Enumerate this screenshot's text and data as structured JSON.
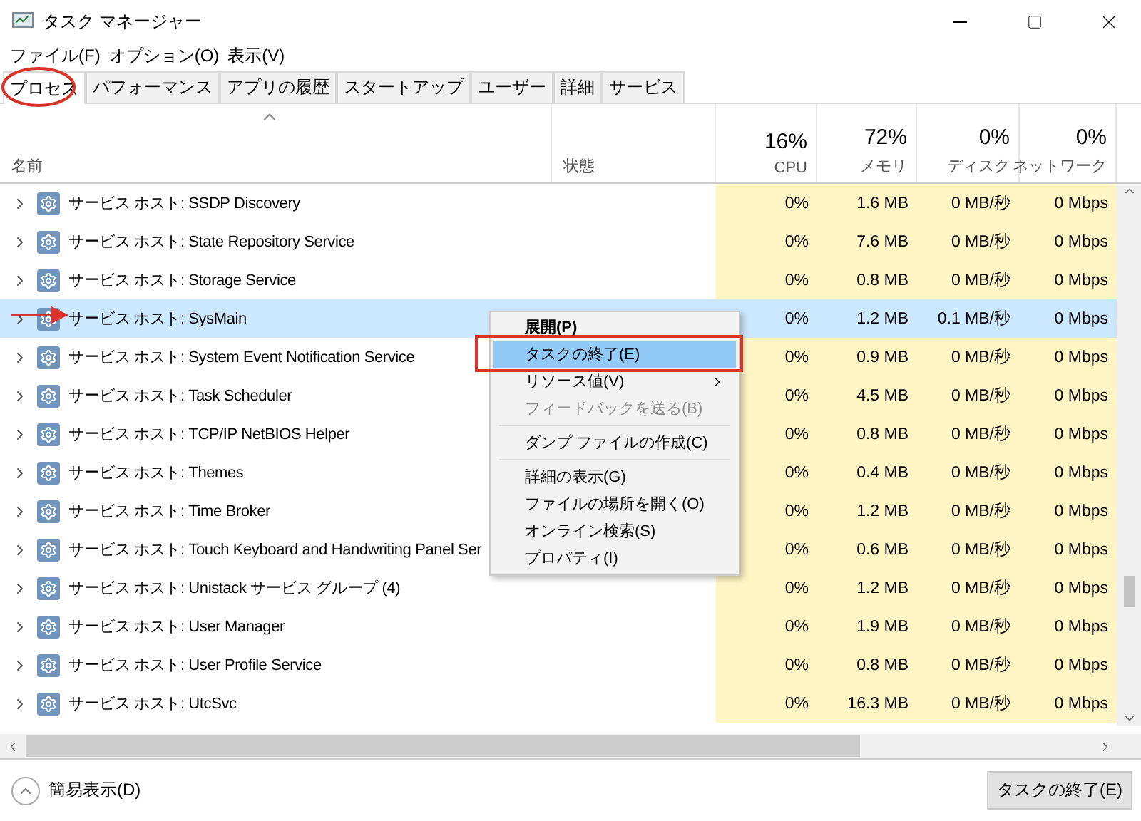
{
  "window": {
    "title": "タスク マネージャー"
  },
  "menu_bar": [
    "ファイル(F)",
    "オプション(O)",
    "表示(V)"
  ],
  "tabs": [
    {
      "label": "プロセス",
      "selected": true
    },
    {
      "label": "パフォーマンス",
      "selected": false
    },
    {
      "label": "アプリの履歴",
      "selected": false
    },
    {
      "label": "スタートアップ",
      "selected": false
    },
    {
      "label": "ユーザー",
      "selected": false
    },
    {
      "label": "詳細",
      "selected": false
    },
    {
      "label": "サービス",
      "selected": false
    }
  ],
  "columns": [
    {
      "kind": "text",
      "label": "名前",
      "sorted": true
    },
    {
      "kind": "text",
      "label": "状態",
      "sorted": false
    },
    {
      "kind": "metric",
      "percent": "16%",
      "label": "CPU",
      "sorted": false
    },
    {
      "kind": "metric",
      "percent": "72%",
      "label": "メモリ",
      "sorted": false
    },
    {
      "kind": "metric",
      "percent": "0%",
      "label": "ディスク",
      "sorted": false
    },
    {
      "kind": "metric",
      "percent": "0%",
      "label": "ネットワーク",
      "sorted": false
    }
  ],
  "rows": [
    {
      "name": "サービス ホスト: SSDP Discovery",
      "selected": false,
      "cpu": "0%",
      "memory": "1.6 MB",
      "disk": "0 MB/秒",
      "network": "0 Mbps"
    },
    {
      "name": "サービス ホスト: State Repository Service",
      "selected": false,
      "cpu": "0%",
      "memory": "7.6 MB",
      "disk": "0 MB/秒",
      "network": "0 Mbps"
    },
    {
      "name": "サービス ホスト: Storage Service",
      "selected": false,
      "cpu": "0%",
      "memory": "0.8 MB",
      "disk": "0 MB/秒",
      "network": "0 Mbps"
    },
    {
      "name": "サービス ホスト: SysMain",
      "selected": true,
      "cpu": "0%",
      "memory": "1.2 MB",
      "disk": "0.1 MB/秒",
      "network": "0 Mbps"
    },
    {
      "name": "サービス ホスト: System Event Notification Service",
      "selected": false,
      "cpu": "0%",
      "memory": "0.9 MB",
      "disk": "0 MB/秒",
      "network": "0 Mbps"
    },
    {
      "name": "サービス ホスト: Task Scheduler",
      "selected": false,
      "cpu": "0%",
      "memory": "4.5 MB",
      "disk": "0 MB/秒",
      "network": "0 Mbps"
    },
    {
      "name": "サービス ホスト: TCP/IP NetBIOS Helper",
      "selected": false,
      "cpu": "0%",
      "memory": "0.8 MB",
      "disk": "0 MB/秒",
      "network": "0 Mbps"
    },
    {
      "name": "サービス ホスト: Themes",
      "selected": false,
      "cpu": "0%",
      "memory": "0.4 MB",
      "disk": "0 MB/秒",
      "network": "0 Mbps"
    },
    {
      "name": "サービス ホスト: Time Broker",
      "selected": false,
      "cpu": "0%",
      "memory": "1.2 MB",
      "disk": "0 MB/秒",
      "network": "0 Mbps"
    },
    {
      "name": "サービス ホスト: Touch Keyboard and Handwriting Panel Ser",
      "selected": false,
      "cpu": "0%",
      "memory": "0.6 MB",
      "disk": "0 MB/秒",
      "network": "0 Mbps"
    },
    {
      "name": "サービス ホスト: Unistack サービス グループ (4)",
      "selected": false,
      "cpu": "0%",
      "memory": "1.2 MB",
      "disk": "0 MB/秒",
      "network": "0 Mbps"
    },
    {
      "name": "サービス ホスト: User Manager",
      "selected": false,
      "cpu": "0%",
      "memory": "1.9 MB",
      "disk": "0 MB/秒",
      "network": "0 Mbps"
    },
    {
      "name": "サービス ホスト: User Profile Service",
      "selected": false,
      "cpu": "0%",
      "memory": "0.8 MB",
      "disk": "0 MB/秒",
      "network": "0 Mbps"
    },
    {
      "name": "サービス ホスト: UtcSvc",
      "selected": false,
      "cpu": "0%",
      "memory": "16.3 MB",
      "disk": "0 MB/秒",
      "network": "0 Mbps"
    }
  ],
  "context_menu": {
    "groups": [
      [
        {
          "label": "展開(P)",
          "default": true,
          "selected": false,
          "disabled": false,
          "submenu": false
        },
        {
          "label": "タスクの終了(E)",
          "default": false,
          "selected": true,
          "disabled": false,
          "submenu": false
        },
        {
          "label": "リソース値(V)",
          "default": false,
          "selected": false,
          "disabled": false,
          "submenu": true
        },
        {
          "label": "フィードバックを送る(B)",
          "default": false,
          "selected": false,
          "disabled": true,
          "submenu": false
        }
      ],
      [
        {
          "label": "ダンプ ファイルの作成(C)",
          "default": false,
          "selected": false,
          "disabled": false,
          "submenu": false
        }
      ],
      [
        {
          "label": "詳細の表示(G)",
          "default": false,
          "selected": false,
          "disabled": false,
          "submenu": false
        },
        {
          "label": "ファイルの場所を開く(O)",
          "default": false,
          "selected": false,
          "disabled": false,
          "submenu": false
        },
        {
          "label": "オンライン検索(S)",
          "default": false,
          "selected": false,
          "disabled": false,
          "submenu": false
        },
        {
          "label": "プロパティ(I)",
          "default": false,
          "selected": false,
          "disabled": false,
          "submenu": false
        }
      ]
    ]
  },
  "footer": {
    "toggle_label": "簡易表示(D)",
    "end_task_button": "タスクの終了(E)"
  },
  "annotations": [
    {
      "kind": "ellipse"
    },
    {
      "kind": "arrow"
    },
    {
      "kind": "frame"
    }
  ]
}
